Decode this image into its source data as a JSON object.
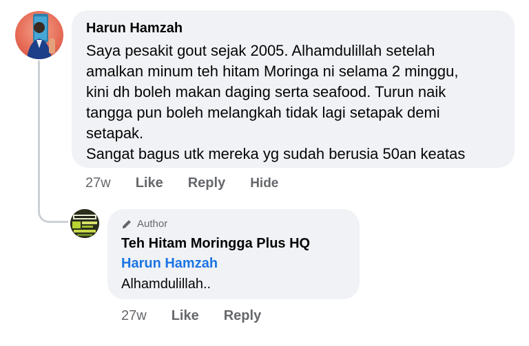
{
  "comment": {
    "author": "Harun Hamzah",
    "lines": [
      "Saya pesakit gout sejak 2005. Alhamdulillah setelah",
      "amalkan minum teh hitam Moringa ni selama 2 minggu,",
      "kini dh boleh makan daging serta seafood. Turun naik",
      "tangga pun boleh melangkah tidak lagi setapak demi",
      "setapak.",
      "Sangat bagus utk mereka yg sudah berusia 50an keatas"
    ],
    "actions": {
      "time": "27w",
      "like": "Like",
      "reply": "Reply",
      "hide": "Hide"
    }
  },
  "reply": {
    "badge": "Author",
    "author": "Teh Hitam Moringga Plus HQ",
    "mention": "Harun Hamzah",
    "text": "Alhamdulillah..",
    "actions": {
      "time": "27w",
      "like": "Like",
      "reply": "Reply"
    }
  }
}
